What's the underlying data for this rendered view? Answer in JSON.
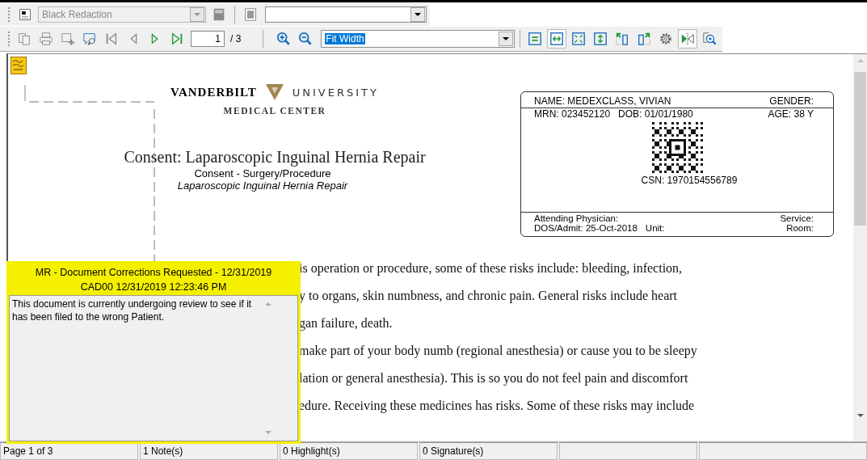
{
  "redaction_toolbar": {
    "style_combo": {
      "value": "Black Redaction",
      "disabled": true
    },
    "second_combo": {
      "disabled": false
    }
  },
  "navigation_toolbar": {
    "left_buttons": [
      {
        "kind": "pages",
        "pressed": false
      },
      {
        "kind": "print",
        "pressed": false
      },
      {
        "kind": "add-page",
        "pressed": false
      },
      {
        "kind": "find-note",
        "pressed": false
      },
      {
        "kind": "first",
        "pressed": false
      },
      {
        "kind": "prev",
        "pressed": false
      },
      {
        "kind": "next",
        "pressed": false
      },
      {
        "kind": "last",
        "pressed": false
      }
    ],
    "page_input": "1",
    "page_total": "/ 3",
    "zoom_buttons": [
      {
        "kind": "zoom-in",
        "pressed": false
      },
      {
        "kind": "zoom-out",
        "pressed": false
      }
    ],
    "zoom_combo": "Fit Width",
    "right_buttons": [
      {
        "kind": "fit-page",
        "pressed": false
      },
      {
        "kind": "fit-width",
        "pressed": true
      },
      {
        "kind": "fit-all",
        "pressed": false
      },
      {
        "kind": "fit-height",
        "pressed": false
      },
      {
        "kind": "rotate-left",
        "pressed": false
      },
      {
        "kind": "rotate-right",
        "pressed": false
      },
      {
        "kind": "gear",
        "pressed": false
      },
      {
        "kind": "mirror",
        "pressed": true
      },
      {
        "kind": "zoom-area",
        "pressed": false
      }
    ]
  },
  "document": {
    "logo_left": "VANDERBILT",
    "logo_right": "UNIVERSITY",
    "logo_sub": "MEDICAL CENTER",
    "title": "Consent: Laparoscopic Inguinal Hernia Repair",
    "doc_type": "Consent - Surgery/Procedure",
    "doc_name": "Laparoscopic Inguinal Hernia Repair",
    "patient_label": {
      "name": "NAME: MEDEXCLASS, VIVIAN",
      "gender": "GENDER:",
      "mrn": "MRN: 023452120",
      "dob": "DOB: 01/01/1980",
      "age": "AGE: 38 Y",
      "csn": "CSN: 1970154556789",
      "attending": "Attending Physician:",
      "service": "Service:",
      "dos": "DOS/Admit: 25-Oct-2018",
      "unit": "Unit:",
      "room": "Room:"
    },
    "body_lines": [
      "is operation or procedure, some of these risks include: bleeding, infection,",
      "y to organs, skin numbness, and chronic pain. General risks include heart",
      "gan failure, death.",
      "make part of your body numb (regional anesthesia) or cause you to be sleepy",
      "lation or general anesthesia). This is so you do not feel pain and discomfort",
      "edure. Receiving these medicines has risks. Some of these risks may include"
    ]
  },
  "note": {
    "title": "MR - Document Corrections Requested - 12/31/2019",
    "author_time": "CAD00 12/31/2019 12:23:46 PM",
    "text": "This document is currently undergoing review to see if it has been filed to the wrong Patient."
  },
  "status_bar": [
    "Page 1 of 3",
    "1 Note(s)",
    "0 Highlight(s)",
    "0 Signature(s)"
  ]
}
